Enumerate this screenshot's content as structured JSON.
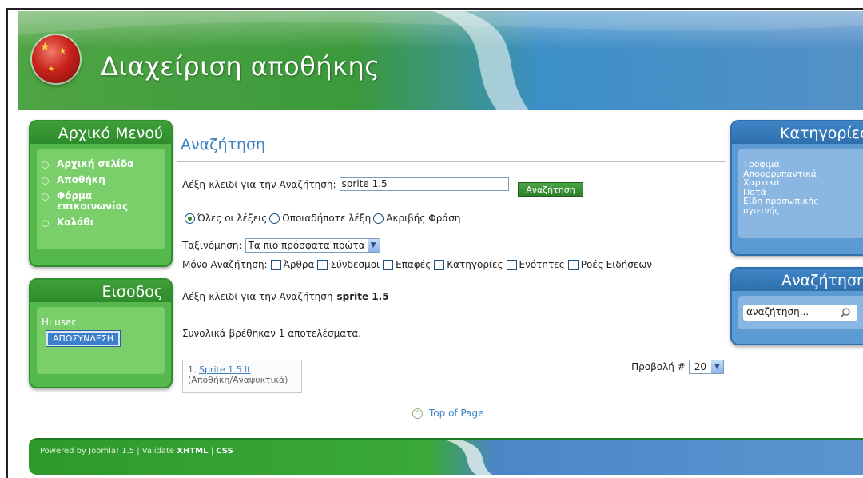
{
  "header": {
    "title": "Διαχείριση αποθήκης"
  },
  "main_menu": {
    "title": "Αρχικό Μενού",
    "items": [
      "Αρχική σελίδα",
      "Αποθήκη",
      "Φόρμα επικοινωνίας",
      "Καλάθι"
    ]
  },
  "login": {
    "title": "Εισοδος",
    "greeting": "Hi user",
    "logout_label": "ΑΠΟΣΥΝΔΕΣΗ"
  },
  "categories": {
    "title": "Κατηγορίες",
    "items": [
      "Τρόφιμα",
      "Αποορρυπαντικά",
      "Χαρτικά",
      "Ποτά",
      "Είδη προσωπικής υγιεινής"
    ]
  },
  "sidebar_search": {
    "title": "Αναζήτηση",
    "value": "αναζήτηση..."
  },
  "search_page": {
    "title": "Αναζήτηση",
    "keyword_label": "Λέξη-κλειδί για την Αναζήτηση:",
    "keyword_value": "sprite 1.5",
    "search_button": "Αναζήτηση",
    "radio_options": [
      "Όλες οι λέξεις",
      "Οποιαδήποτε λέξη",
      "Ακριβής Φράση"
    ],
    "radio_selected": 0,
    "ordering_label": "Ταξινόμηση:",
    "ordering_value": "Τα πιο πρόσφατα πρώτα",
    "only_label": "Μόνο Αναζήτηση:",
    "only_options": [
      "Άρθρα",
      "Σύνδεσμοι",
      "Επαφές",
      "Κατηγορίες",
      "Ενότητες",
      "Ροές Ειδήσεων"
    ],
    "keyword_summary_label": "Λέξη-κλειδί για την Αναζήτηση",
    "keyword_summary_value": "sprite 1.5",
    "total_results": "Συνολικά βρέθηκαν 1 αποτελέσματα.",
    "display_label": "Προβολή #",
    "display_value": "20",
    "results": [
      {
        "num": "1.",
        "title": "Sprite 1.5 lt",
        "section": "(Αποθήκη/Αναψυκτικά)"
      }
    ],
    "top_link": "Top of Page"
  },
  "footer": {
    "powered": "Powered by Joomla! 1.5 | Validate",
    "xhtml": "XHTML",
    "separator": "|",
    "css": "CSS"
  },
  "colors": {
    "green": "#3b9a3b",
    "blue": "#3c82c3"
  }
}
